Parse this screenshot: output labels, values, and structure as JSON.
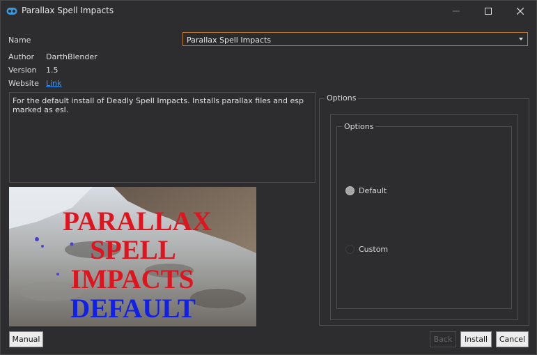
{
  "window": {
    "title": "Parallax Spell Impacts"
  },
  "fields": {
    "name_label": "Name",
    "name_value": "Parallax Spell Impacts",
    "author_label": "Author",
    "author_value": "DarthBlender",
    "version_label": "Version",
    "version_value": "1.5",
    "website_label": "Website",
    "website_link": "Link"
  },
  "description": "For the default install of Deadly Spell Impacts. Installs parallax files and esp marked as esl.",
  "preview_text": {
    "line1": "PARALLAX",
    "line2": "SPELL",
    "line3": "IMPACTS",
    "line4": "DEFAULT"
  },
  "options": {
    "outer_title": "Options",
    "inner_title": "Options",
    "items": [
      {
        "label": "Default",
        "selected": true
      },
      {
        "label": "Custom",
        "selected": false
      }
    ]
  },
  "buttons": {
    "manual": "Manual",
    "back": "Back",
    "install": "Install",
    "cancel": "Cancel"
  },
  "colors": {
    "accent_border": "#c37a2f",
    "link": "#3399ff",
    "preview_red": "#e0141e",
    "preview_blue": "#1020e8"
  }
}
